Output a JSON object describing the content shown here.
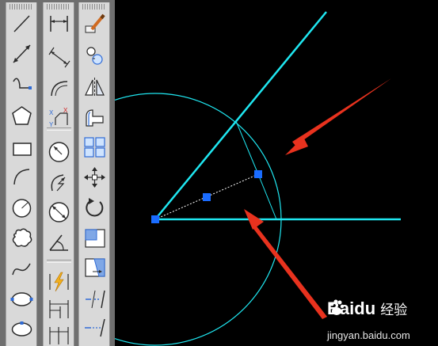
{
  "toolbars": {
    "draw": [
      "line-icon",
      "construction-line-icon",
      "polyline-icon",
      "polygon-icon",
      "rectangle-icon",
      "arc-icon",
      "circle-icon",
      "revision-cloud-icon",
      "spline-icon",
      "ellipse-icon",
      "ellipse-arc-icon"
    ],
    "dimension": [
      "linear-dimension-icon",
      "aligned-dimension-icon",
      "arc-length-icon",
      "ordinate-dimension-icon",
      "radius-dimension-icon",
      "jogged-radius-icon",
      "diameter-dimension-icon",
      "angular-dimension-icon",
      "quick-dimension-icon",
      "baseline-dimension-icon",
      "continue-dimension-icon"
    ],
    "modify": [
      "match-properties-icon",
      "copy-objects-icon",
      "mirror-icon",
      "offset-icon",
      "array-icon",
      "move-icon",
      "rotate-icon",
      "scale-icon",
      "stretch-icon",
      "trim-icon",
      "extend-icon"
    ]
  },
  "colors": {
    "geometry": "#1fe6f0",
    "grip": "#1a6cff",
    "arrow": "#e8321e",
    "canvas": "#000000"
  },
  "watermark": {
    "logo_text": "Bai",
    "logo_suffix": "du",
    "logo_cn": "经验",
    "url": "jingyan.baidu.com"
  }
}
